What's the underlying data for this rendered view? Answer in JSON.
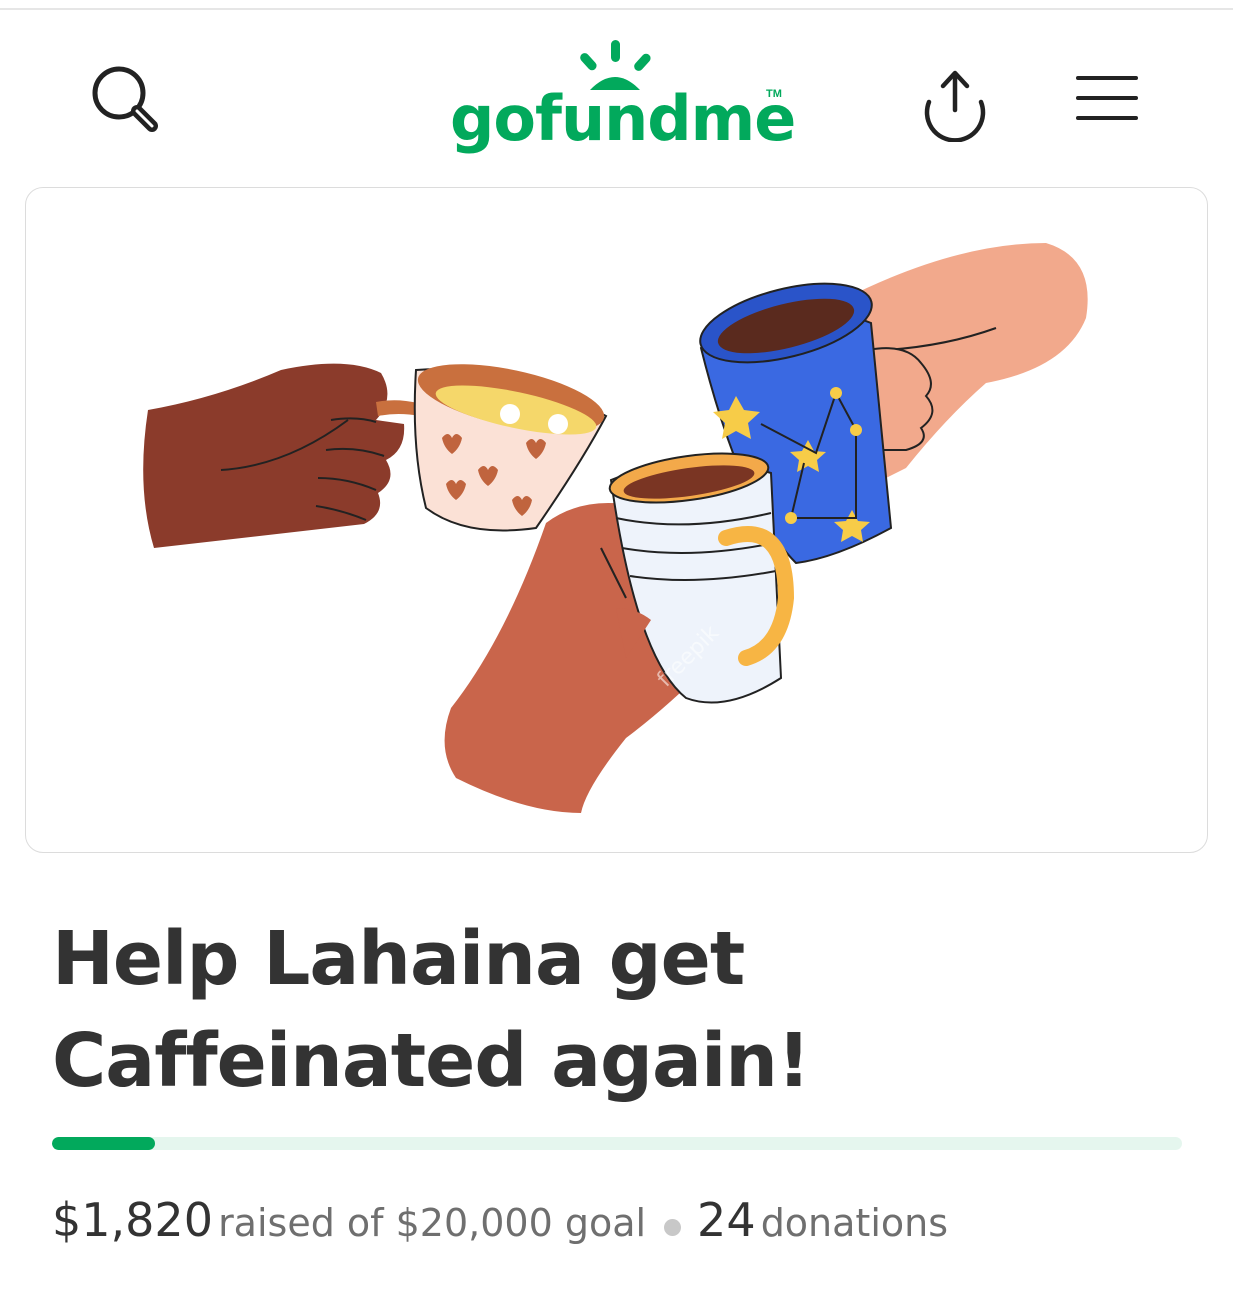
{
  "header": {
    "logo_text": "gofundme",
    "logo_tm": "TM",
    "icons": {
      "search": "search-icon",
      "share": "share-upload-icon",
      "menu": "hamburger-menu-icon"
    },
    "brand_color": "#02a95c"
  },
  "hero": {
    "watermark": "freepik"
  },
  "campaign": {
    "title": "Help Lahaina get Caffeinated again!",
    "raised_amount": "$1,820",
    "raised_label": "raised of $20,000 goal",
    "donations_count": "24",
    "donations_label": "donations",
    "progress_fraction": 0.091
  }
}
